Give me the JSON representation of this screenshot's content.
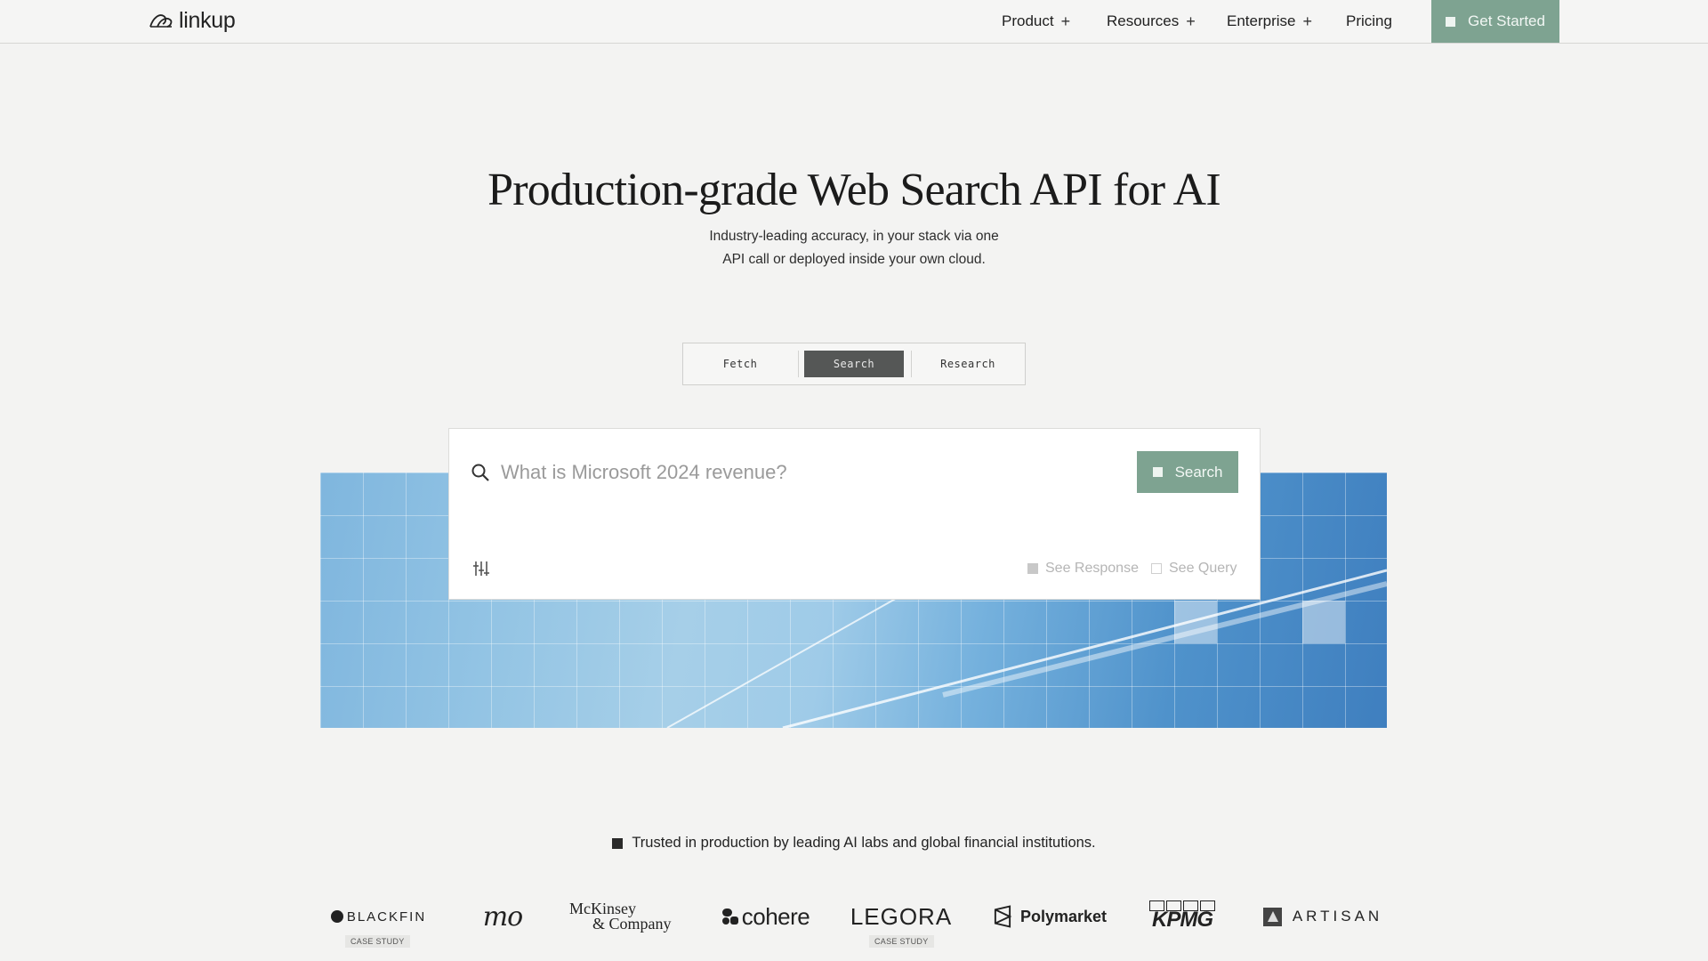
{
  "nav": {
    "logo_text": "linkup",
    "items": [
      {
        "label": "Product",
        "has_plus": true
      },
      {
        "label": "Resources",
        "has_plus": true
      },
      {
        "label": "Enterprise",
        "has_plus": true
      },
      {
        "label": "Pricing",
        "has_plus": false
      }
    ],
    "plus_symbol": "+",
    "cta_label": "Get Started"
  },
  "hero": {
    "title": "Production-grade Web Search API for AI",
    "subtitle_line1": "Industry-leading accuracy, in your stack via one",
    "subtitle_line2": "API call or deployed inside your own cloud."
  },
  "tabs": [
    {
      "label": "Fetch",
      "active": false
    },
    {
      "label": "Search",
      "active": true
    },
    {
      "label": "Research",
      "active": false
    }
  ],
  "search": {
    "placeholder": "What is Microsoft 2024 revenue?",
    "value": "",
    "button_label": "Search",
    "toggles": [
      {
        "label": "See Response",
        "checked": true
      },
      {
        "label": "See Query",
        "checked": false
      }
    ]
  },
  "trusted": {
    "text": "Trusted in production by leading AI labs and global financial institutions."
  },
  "logos": [
    {
      "name": "BLACKFIN",
      "case_study": "CASE STUDY"
    },
    {
      "name": "mo",
      "case_study": ""
    },
    {
      "name_line1": "McKinsey",
      "name_line2": "& Company",
      "case_study": ""
    },
    {
      "name": "cohere",
      "case_study": ""
    },
    {
      "name": "LEGORA",
      "case_study": "CASE STUDY"
    },
    {
      "name": "Polymarket",
      "case_study": ""
    },
    {
      "name": "KPMG",
      "case_study": ""
    },
    {
      "name": "ARTISAN",
      "case_study": ""
    }
  ],
  "colors": {
    "accent_green": "#7ea391",
    "active_tab": "#555756",
    "background": "#f3f3f2"
  }
}
